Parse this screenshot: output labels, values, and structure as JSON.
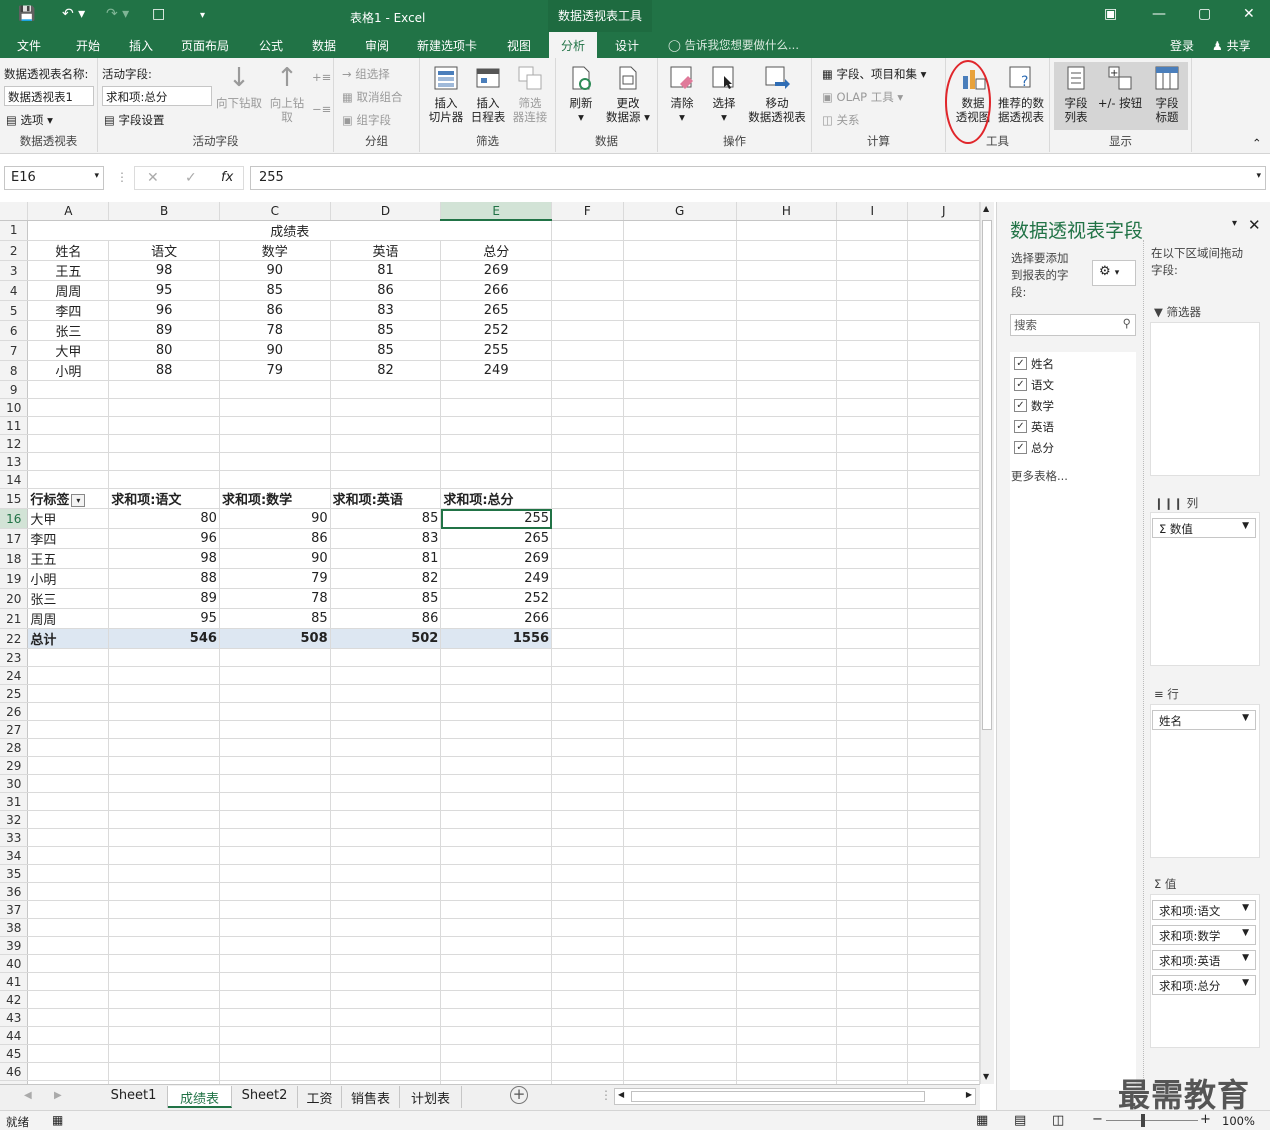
{
  "titlebar": {
    "title": "表格1 - Excel",
    "context_tab": "数据透视表工具"
  },
  "tabs": {
    "file": "文件",
    "home": "开始",
    "insert": "插入",
    "layout": "页面布局",
    "formula": "公式",
    "data": "数据",
    "review": "审阅",
    "newtab": "新建选项卡",
    "view": "视图",
    "analyze": "分析",
    "design": "设计",
    "tell_me": "告诉我您想要做什么...",
    "login": "登录",
    "share": "共享"
  },
  "ribbon": {
    "pt_name_label": "数据透视表名称:",
    "pt_name_value": "数据透视表1",
    "options": "选项",
    "group_pt": "数据透视表",
    "active_field_label": "活动字段:",
    "active_field_value": "求和项:总分",
    "field_settings": "字段设置",
    "drill_down": "向下钻取",
    "drill_up_1": "向上钻",
    "drill_up_2": "取",
    "group_active": "活动字段",
    "group_selection": "组选择",
    "ungroup": "取消组合",
    "group_field": "组字段",
    "group_group": "分组",
    "slicer_1": "插入",
    "slicer_2": "切片器",
    "timeline_1": "插入",
    "timeline_2": "日程表",
    "filter_conn_1": "筛选",
    "filter_conn_2": "器连接",
    "group_filter": "筛选",
    "refresh": "刷新",
    "change_src_1": "更改",
    "change_src_2": "数据源",
    "group_data": "数据",
    "clear": "清除",
    "select": "选择",
    "move_1": "移动",
    "move_2": "数据透视表",
    "group_actions": "操作",
    "fields_items": "字段、项目和集",
    "olap": "OLAP 工具",
    "relations": "关系",
    "group_calc": "计算",
    "pivot_chart_1": "数据",
    "pivot_chart_2": "透视图",
    "recommended_1": "推荐的数",
    "recommended_2": "据透视表",
    "group_tools": "工具",
    "field_list_1": "字段",
    "field_list_2": "列表",
    "plusminus": "+/- 按钮",
    "field_headers_1": "字段",
    "field_headers_2": "标题",
    "group_show": "显示"
  },
  "formula_bar": {
    "name_box": "E16",
    "value": "255"
  },
  "columns": [
    "A",
    "B",
    "C",
    "D",
    "E",
    "F",
    "G",
    "H",
    "I",
    "J"
  ],
  "source_table": {
    "title": "成绩表",
    "headers": [
      "姓名",
      "语文",
      "数学",
      "英语",
      "总分"
    ],
    "rows": [
      [
        "王五",
        "98",
        "90",
        "81",
        "269"
      ],
      [
        "周周",
        "95",
        "85",
        "86",
        "266"
      ],
      [
        "李四",
        "96",
        "86",
        "83",
        "265"
      ],
      [
        "张三",
        "89",
        "78",
        "85",
        "252"
      ],
      [
        "大甲",
        "80",
        "90",
        "85",
        "255"
      ],
      [
        "小明",
        "88",
        "79",
        "82",
        "249"
      ]
    ]
  },
  "pivot_table": {
    "headers": [
      "行标签",
      "求和项:语文",
      "求和项:数学",
      "求和项:英语",
      "求和项:总分"
    ],
    "rows": [
      [
        "大甲",
        "80",
        "90",
        "85",
        "255"
      ],
      [
        "李四",
        "96",
        "86",
        "83",
        "265"
      ],
      [
        "王五",
        "98",
        "90",
        "81",
        "269"
      ],
      [
        "小明",
        "88",
        "79",
        "82",
        "249"
      ],
      [
        "张三",
        "89",
        "78",
        "85",
        "252"
      ],
      [
        "周周",
        "95",
        "85",
        "86",
        "266"
      ]
    ],
    "total": [
      "总计",
      "546",
      "508",
      "502",
      "1556"
    ]
  },
  "field_pane": {
    "title": "数据透视表字段",
    "choose_1": "选择要添加",
    "choose_2": "到报表的字",
    "choose_3": "段:",
    "drag_1": "在以下区域间拖动",
    "drag_2": "字段:",
    "search_placeholder": "搜索",
    "fields": [
      "姓名",
      "语文",
      "数学",
      "英语",
      "总分"
    ],
    "more_tables": "更多表格...",
    "filters_label": "筛选器",
    "columns_label": "列",
    "columns_items": [
      "Σ 数值"
    ],
    "rows_label": "行",
    "rows_items": [
      "姓名"
    ],
    "values_label": "值",
    "values_items": [
      "求和项:语文",
      "求和项:数学",
      "求和项:英语",
      "求和项:总分"
    ]
  },
  "sheets": [
    "Sheet1",
    "成绩表",
    "Sheet2",
    "工资",
    "销售表",
    "计划表"
  ],
  "active_sheet": "成绩表",
  "status": {
    "ready": "就绪",
    "zoom": "100%"
  },
  "watermark": "最需教育",
  "colors": {
    "excel_green": "#217346",
    "pivot_total_bg": "#dde7f2",
    "highlight_circle": "#e0262b"
  }
}
